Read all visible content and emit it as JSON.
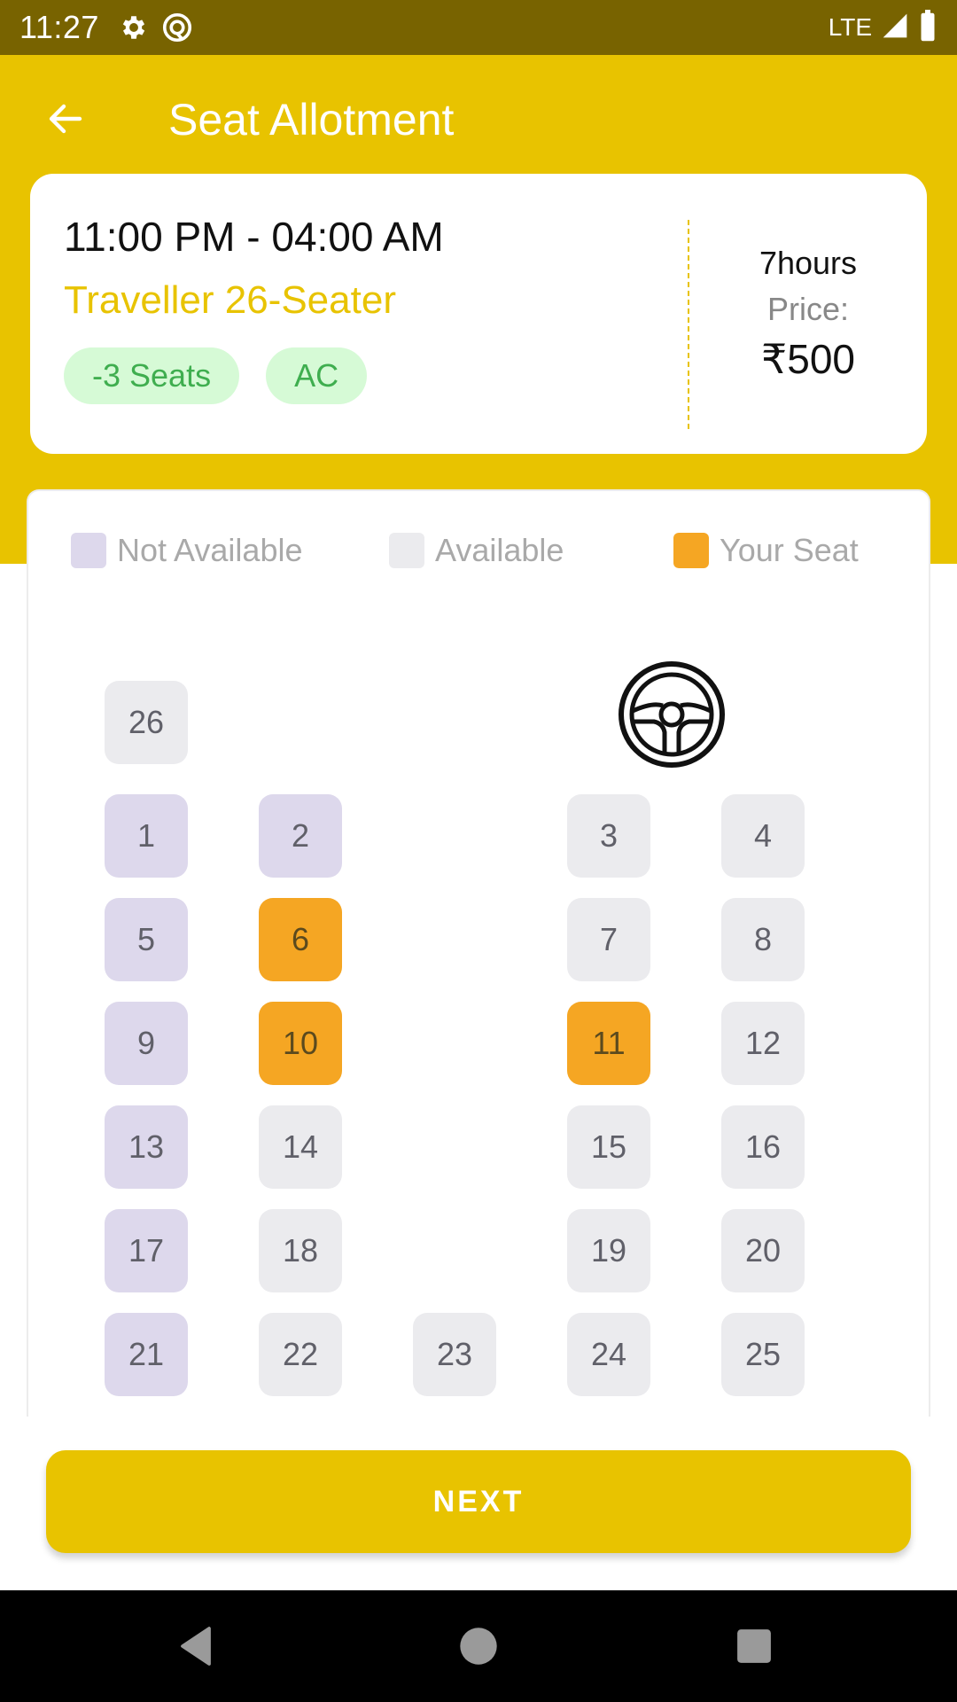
{
  "status_bar": {
    "time": "11:27",
    "network": "LTE",
    "icons": [
      "gear-icon",
      "at-sign-icon",
      "signal-icon",
      "battery-icon"
    ]
  },
  "header": {
    "title": "Seat Allotment",
    "back_icon": "arrow-left-icon"
  },
  "trip": {
    "time_range": "11:00 PM - 04:00 AM",
    "vehicle": "Traveller 26-Seater",
    "chips": [
      "-3 Seats",
      "AC"
    ],
    "duration": "7hours",
    "price_label": "Price:",
    "price": "₹500"
  },
  "legend": [
    {
      "label": "Not Available",
      "status": "not-available",
      "color": "#DDD8EC"
    },
    {
      "label": "Available",
      "status": "available",
      "color": "#EBEBEE"
    },
    {
      "label": "Your Seat",
      "status": "your-seat",
      "color": "#F5A623"
    }
  ],
  "driver_icon": "steering-wheel-icon",
  "seat_layout": {
    "rows": [
      [
        {
          "number": "26",
          "status": "available"
        },
        null,
        null,
        null,
        null
      ],
      [
        {
          "number": "1",
          "status": "not-available"
        },
        {
          "number": "2",
          "status": "not-available"
        },
        null,
        {
          "number": "3",
          "status": "available"
        },
        {
          "number": "4",
          "status": "available"
        }
      ],
      [
        {
          "number": "5",
          "status": "not-available"
        },
        {
          "number": "6",
          "status": "your-seat"
        },
        null,
        {
          "number": "7",
          "status": "available"
        },
        {
          "number": "8",
          "status": "available"
        }
      ],
      [
        {
          "number": "9",
          "status": "not-available"
        },
        {
          "number": "10",
          "status": "your-seat"
        },
        null,
        {
          "number": "11",
          "status": "your-seat"
        },
        {
          "number": "12",
          "status": "available"
        }
      ],
      [
        {
          "number": "13",
          "status": "not-available"
        },
        {
          "number": "14",
          "status": "available"
        },
        null,
        {
          "number": "15",
          "status": "available"
        },
        {
          "number": "16",
          "status": "available"
        }
      ],
      [
        {
          "number": "17",
          "status": "not-available"
        },
        {
          "number": "18",
          "status": "available"
        },
        null,
        {
          "number": "19",
          "status": "available"
        },
        {
          "number": "20",
          "status": "available"
        }
      ],
      [
        {
          "number": "21",
          "status": "not-available"
        },
        {
          "number": "22",
          "status": "available"
        },
        {
          "number": "23",
          "status": "available"
        },
        {
          "number": "24",
          "status": "available"
        },
        {
          "number": "25",
          "status": "available"
        }
      ]
    ]
  },
  "actions": {
    "next_label": "NEXT"
  },
  "colors": {
    "primary": "#E8C300",
    "status_bar": "#786300",
    "chip_bg": "#D6FAD6",
    "chip_text": "#3FAE4F"
  },
  "nav_bar": {
    "buttons": [
      "back-nav-icon",
      "home-nav-icon",
      "recents-nav-icon"
    ]
  }
}
